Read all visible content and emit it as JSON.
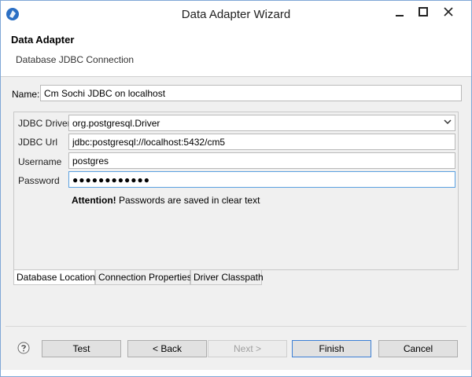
{
  "window": {
    "title": "Data Adapter Wizard",
    "accent": "#3c7fd5"
  },
  "banner": {
    "title": "Data Adapter",
    "subtitle": "Database JDBC Connection"
  },
  "form": {
    "name_label": "Name:",
    "name_value": "Cm Sochi JDBC on localhost",
    "driver_label": "JDBC Driver",
    "driver_value": "org.postgresql.Driver",
    "url_label": "JDBC Url",
    "url_value": "jdbc:postgresql://localhost:5432/cm5",
    "username_label": "Username",
    "username_value": "postgres",
    "password_label": "Password",
    "password_value": "●●●●●●●●●●●●"
  },
  "attention": {
    "strong": "Attention!",
    "text": " Passwords are saved in clear text"
  },
  "tabs": [
    {
      "label": "Database Location",
      "active": true
    },
    {
      "label": "Connection Properties",
      "active": false
    },
    {
      "label": "Driver Classpath",
      "active": false
    }
  ],
  "buttons": {
    "test": "Test",
    "back": "< Back",
    "next": "Next >",
    "finish": "Finish",
    "cancel": "Cancel"
  },
  "icons": {
    "app": "jaspersoft-icon",
    "help": "help-icon",
    "combo": "chevron-down-icon"
  }
}
